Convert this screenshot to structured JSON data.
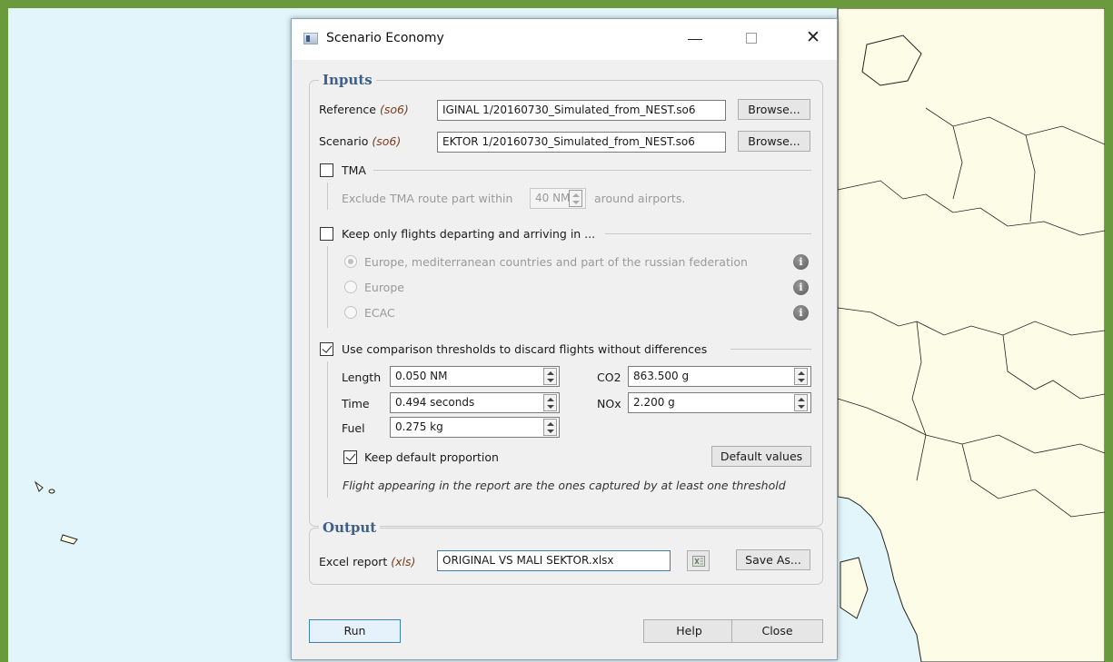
{
  "dialog": {
    "title": "Scenario Economy",
    "close_glyph": "✕"
  },
  "inputs": {
    "title": "Inputs",
    "reference_label": "Reference",
    "reference_ext": "(so6)",
    "reference_value": "IGINAL 1/20160730_Simulated_from_NEST.so6",
    "scenario_label": "Scenario",
    "scenario_ext": "(so6)",
    "scenario_value": "EKTOR 1/20160730_Simulated_from_NEST.so6",
    "browse_label": "Browse..."
  },
  "tma": {
    "label": "TMA",
    "checked": false,
    "text_before": "Exclude TMA route part within",
    "value": "40 NM",
    "text_after": "around airports."
  },
  "keep_flights": {
    "label": "Keep only flights departing and arriving in ...",
    "checked": false,
    "options": [
      {
        "label": "Europe, mediterranean countries and part of the russian federation",
        "selected": true
      },
      {
        "label": "Europe",
        "selected": false
      },
      {
        "label": "ECAC",
        "selected": false
      }
    ],
    "info_glyph": "i"
  },
  "thresholds": {
    "label": "Use comparison thresholds to discard flights without differences",
    "checked": true,
    "length_label": "Length",
    "length_value": "0.050 NM",
    "time_label": "Time",
    "time_value": "0.494 seconds",
    "fuel_label": "Fuel",
    "fuel_value": "0.275 kg",
    "co2_label": "CO2",
    "co2_value": "863.500 g",
    "nox_label": "NOx",
    "nox_value": "2.200 g",
    "keep_default_label": "Keep default proportion",
    "keep_default_checked": true,
    "default_values_label": "Default values",
    "note": "Flight appearing in the report are the ones captured by at least one threshold"
  },
  "output": {
    "title": "Output",
    "excel_label": "Excel report",
    "excel_ext": "(xls)",
    "excel_value": "ORIGINAL VS MALI SEKTOR.xlsx",
    "save_as_label": "Save As..."
  },
  "footer": {
    "run_label": "Run",
    "help_label": "Help",
    "close_label": "Close"
  },
  "colors": {
    "frame_green": "#6a9a3c",
    "sea": "#e1f5fb",
    "land": "#fdfce6",
    "group_title": "#3f5f86"
  }
}
